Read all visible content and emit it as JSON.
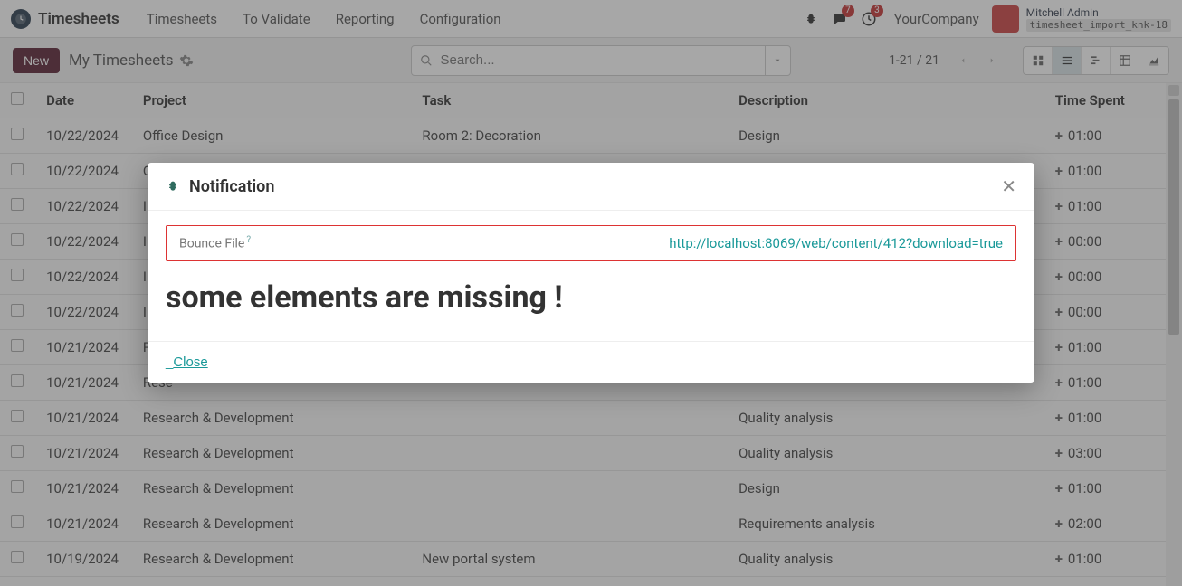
{
  "topnav": {
    "brand": "Timesheets",
    "links": [
      "Timesheets",
      "To Validate",
      "Reporting",
      "Configuration"
    ],
    "badge_messages": "7",
    "badge_activities": "3",
    "company": "YourCompany",
    "user_name": "Mitchell Admin",
    "database": "timesheet_import_knk-18"
  },
  "ctrl": {
    "new_label": "New",
    "breadcrumb": "My Timesheets",
    "search_placeholder": "Search...",
    "pager": "1-21 / 21"
  },
  "columns": {
    "date": "Date",
    "project": "Project",
    "task": "Task",
    "description": "Description",
    "time": "Time Spent"
  },
  "rows": [
    {
      "date": "10/22/2024",
      "project": "Office Design",
      "task": "Room 2: Decoration",
      "desc": "Design",
      "time": "01:00"
    },
    {
      "date": "10/22/2024",
      "project": "Offic",
      "task": "",
      "desc": "",
      "time": "01:00"
    },
    {
      "date": "10/22/2024",
      "project": "Inter",
      "task": "",
      "desc": "",
      "time": "01:00"
    },
    {
      "date": "10/22/2024",
      "project": "Inter",
      "task": "",
      "desc": "",
      "time": "00:00"
    },
    {
      "date": "10/22/2024",
      "project": "Inter",
      "task": "",
      "desc": "",
      "time": "00:00"
    },
    {
      "date": "10/22/2024",
      "project": "Inter",
      "task": "",
      "desc": "",
      "time": "00:00"
    },
    {
      "date": "10/21/2024",
      "project": "Rese",
      "task": "",
      "desc": "",
      "time": "01:00"
    },
    {
      "date": "10/21/2024",
      "project": "Rese",
      "task": "",
      "desc": "",
      "time": "01:00"
    },
    {
      "date": "10/21/2024",
      "project": "Research & Development",
      "task": "",
      "desc": "Quality analysis",
      "time": "01:00"
    },
    {
      "date": "10/21/2024",
      "project": "Research & Development",
      "task": "",
      "desc": "Quality analysis",
      "time": "03:00"
    },
    {
      "date": "10/21/2024",
      "project": "Research & Development",
      "task": "",
      "desc": "Design",
      "time": "01:00"
    },
    {
      "date": "10/21/2024",
      "project": "Research & Development",
      "task": "",
      "desc": "Requirements analysis",
      "time": "02:00"
    },
    {
      "date": "10/19/2024",
      "project": "Research & Development",
      "task": "New portal system",
      "desc": "Quality analysis",
      "time": "01:00"
    }
  ],
  "modal": {
    "title": "Notification",
    "bounce_label": "Bounce File",
    "help_mark": "?",
    "bounce_link": "http://localhost:8069/web/content/412?download=true",
    "message": "some elements are missing !",
    "close_text": "Close",
    "close_prefix": "_"
  }
}
